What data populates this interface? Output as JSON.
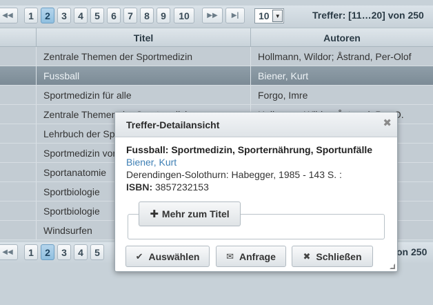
{
  "pager": {
    "first_icon": "first-page-icon",
    "pages": [
      "1",
      "2",
      "3",
      "4",
      "5",
      "6",
      "7",
      "8",
      "9",
      "10"
    ],
    "active_page": "2",
    "next_icon": "next-page-icon",
    "last_icon": "last-page-icon",
    "page_size": "10",
    "hits_text": "Treffer: [11…20] von 250"
  },
  "table": {
    "columns": [
      "Titel",
      "Autoren"
    ],
    "rows": [
      {
        "titel": "Zentrale Themen der Sportmedizin",
        "autoren": "Hollmann, Wildor; Åstrand, Per-Olof"
      },
      {
        "titel": "Fussball",
        "autoren": "Biener, Kurt"
      },
      {
        "titel": "Sportmedizin für alle",
        "autoren": "Forgo, Imre"
      },
      {
        "titel": "Zentrale Themen der Sportmedizin",
        "autoren": "Hollmann, Wildor; Åstrand, Per-O."
      },
      {
        "titel": "Lehrbuch der Sportmedizin",
        "autoren": ""
      },
      {
        "titel": "Sportmedizin von A-Z",
        "autoren": ""
      },
      {
        "titel": "Sportanatomie",
        "autoren": ""
      },
      {
        "titel": "Sportbiologie",
        "autoren": ""
      },
      {
        "titel": "Sportbiologie",
        "autoren": ""
      },
      {
        "titel": "Windsurfen",
        "autoren": ""
      }
    ]
  },
  "pager_bottom": {
    "pages": [
      "1",
      "2",
      "3",
      "4",
      "5"
    ],
    "hits_tail": "on 250"
  },
  "dialog": {
    "title": "Treffer-Detailansicht",
    "close_icon": "close-icon",
    "item_title": "Fussball: Sportmedizin, Sporternährung, Sportunfälle",
    "author": "Biener, Kurt",
    "publication": "Derendingen-Solothurn: Habegger, 1985 - 143 S. :",
    "isbn_label": "ISBN:",
    "isbn": "3857232153",
    "more_button": "Mehr zum Titel",
    "buttons": {
      "select": "Auswählen",
      "request": "Anfrage",
      "close": "Schließen"
    }
  },
  "colors": {
    "accent_active_page": "#9cc8e6",
    "selected_row": "#85949e",
    "author_link": "#3e7fb4"
  }
}
